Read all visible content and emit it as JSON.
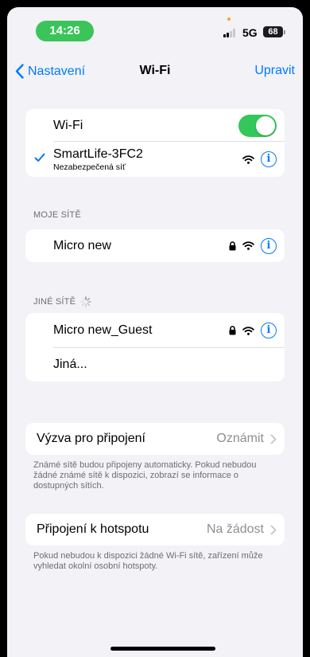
{
  "status_bar": {
    "time": "14:26",
    "network": "5G",
    "battery": "68"
  },
  "nav": {
    "back_label": "Nastavení",
    "title": "Wi-Fi",
    "edit_label": "Upravit"
  },
  "wifi_group": {
    "toggle_label": "Wi-Fi",
    "toggle_on": true,
    "connected": {
      "name": "SmartLife-3FC2",
      "subtitle": "Nezabezpečená síť"
    }
  },
  "my_networks": {
    "header": "MOJE SÍTĚ",
    "items": [
      {
        "name": "Micro new",
        "locked": true
      }
    ]
  },
  "other_networks": {
    "header": "JINÉ SÍTĚ",
    "items": [
      {
        "name": "Micro new_Guest",
        "locked": true
      }
    ],
    "other_label": "Jiná..."
  },
  "ask_to_join": {
    "label": "Výzva pro připojení",
    "value": "Oznámit",
    "footer": "Známé sítě budou připojeny automaticky. Pokud nebudou žádné známé sítě k dispozici, zobrazí se informace o dostupných sítích."
  },
  "hotspot": {
    "label": "Připojení k hotspotu",
    "value": "Na žádost",
    "footer": "Pokud nebudou k dispozici žádné Wi-Fi sítě, zařízení může vyhledat okolní osobní hotspoty."
  },
  "icons": {
    "wifi": "wifi-icon",
    "lock": "lock-icon",
    "info": "info-icon",
    "check": "checkmark-icon",
    "chevron": "chevron-right-icon",
    "spinner": "spinner-icon"
  },
  "colors": {
    "accent": "#007aff",
    "toggle_on": "#34c759",
    "time_pill": "#3bc45a",
    "background": "#f2f2f7"
  }
}
